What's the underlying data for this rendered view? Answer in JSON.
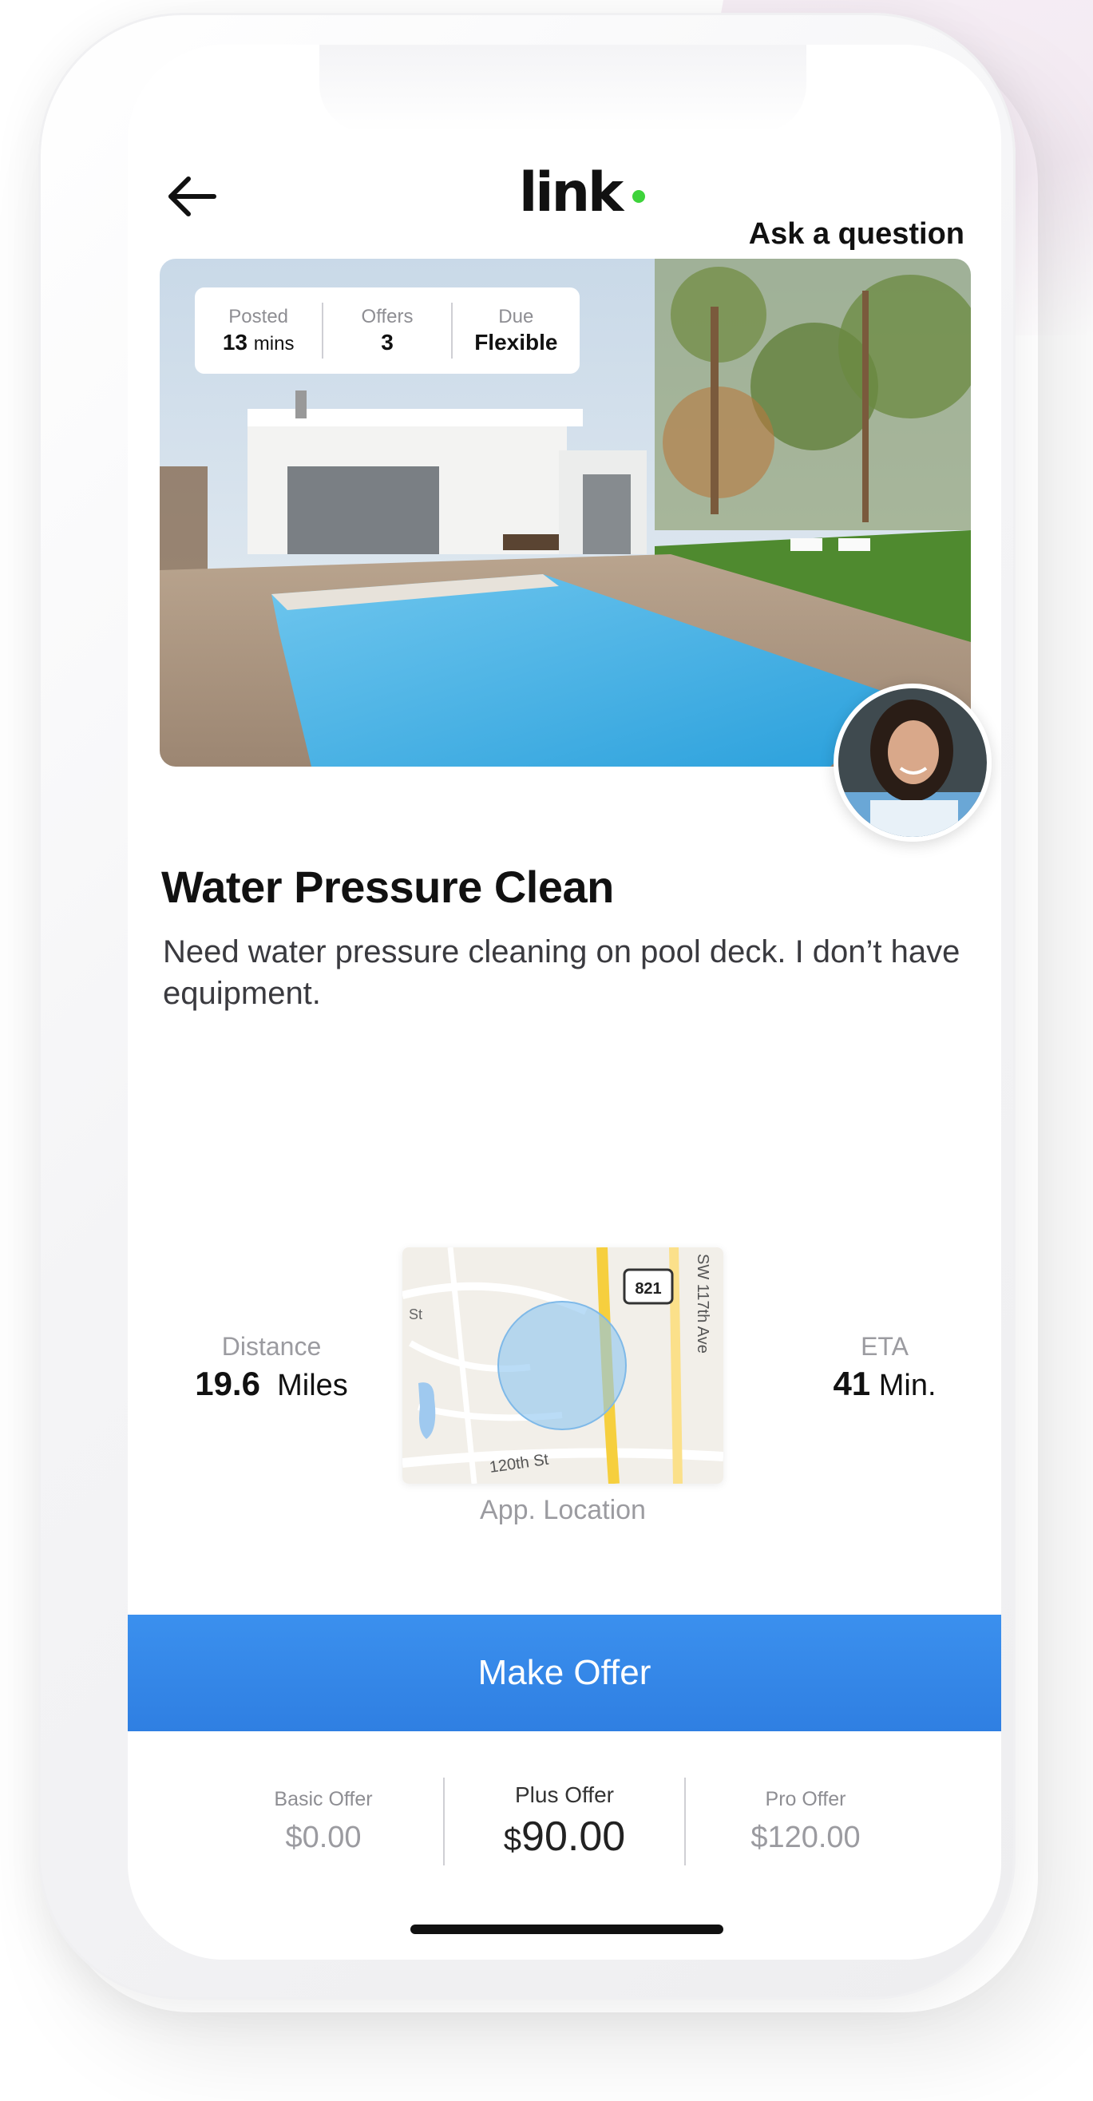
{
  "header": {
    "logo_text": "link",
    "ask_question_label": "Ask a question",
    "back_icon": "arrow-left-icon"
  },
  "job": {
    "stats": {
      "posted_label": "Posted",
      "posted_value": "13",
      "posted_unit": "mins",
      "offers_label": "Offers",
      "offers_value": "3",
      "due_label": "Due",
      "due_value": "Flexible"
    },
    "title": "Water Pressure Clean",
    "description": "Need water pressure cleaning on pool deck. I don’t have equipment."
  },
  "location": {
    "distance_label": "Distance",
    "distance_value": "19.6",
    "distance_unit": "Miles",
    "eta_label": "ETA",
    "eta_value": "41",
    "eta_unit": "Min.",
    "map_caption": "App. Location",
    "map_labels": {
      "street_top": "St",
      "road_sign": "821",
      "avenue": "SW 117th Ave",
      "street_bottom": "120th St"
    }
  },
  "action": {
    "make_offer_label": "Make Offer"
  },
  "offers": [
    {
      "label": "Basic Offer",
      "price": "$0.00"
    },
    {
      "label": "Plus Offer",
      "price_symbol": "$",
      "price_amount": "90.00"
    },
    {
      "label": "Pro Offer",
      "price": "$120.00"
    }
  ],
  "colors": {
    "primary_button": "#3b90ee",
    "logo_dot": "#3ed33b",
    "map_circle": "#8cc4f0"
  }
}
